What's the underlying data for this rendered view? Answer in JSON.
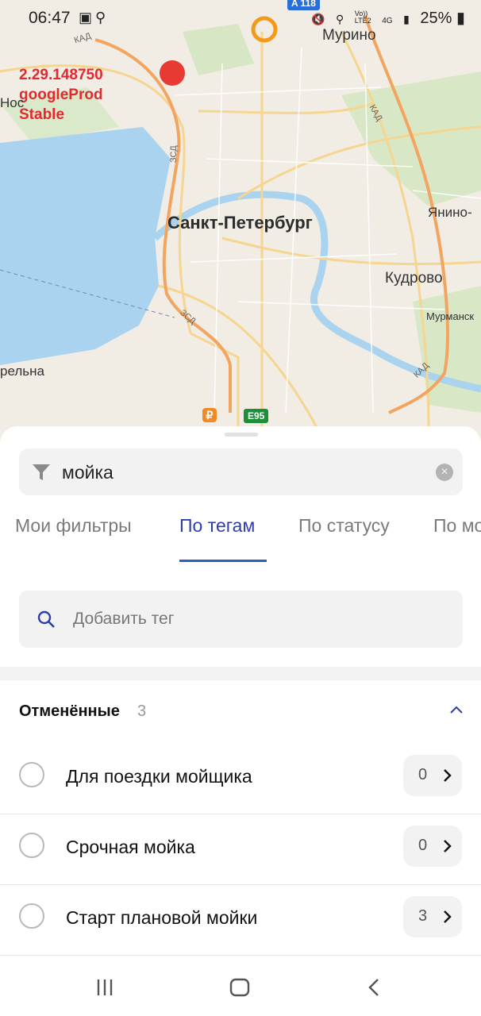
{
  "status_bar": {
    "time": "06:47",
    "left_icons": [
      "image-icon",
      "search-icon"
    ],
    "right_icons": [
      "mute-icon",
      "location-icon",
      "volte-icon",
      "4g-icon",
      "signal-icon"
    ],
    "volte": "Vo))\nLTE2",
    "network": "4G",
    "battery": "25%"
  },
  "map": {
    "build_lines": [
      "2.29.148750",
      "googleProd",
      "Stable"
    ],
    "city": "Санкт-Петербург",
    "places": {
      "murino": "Мурино",
      "yanino": "Янино-",
      "kudrovo": "Кудрово",
      "murmansk": "Мурманск",
      "nos": "Нос",
      "elna": "рельна"
    },
    "highways": {
      "kad_top": "КАД",
      "kad_right": "КАД",
      "kad_bottom": "КАД",
      "zsd_1": "ЗСД",
      "zsd_2": "ЗСД"
    },
    "route_badges": {
      "e95": "E95",
      "a118": "A 118"
    },
    "fuel_symbol": "₽",
    "colors": {
      "marker_red": "#e63a33",
      "marker_orange": "#f39a1a",
      "water": "#a9d3ee"
    }
  },
  "search": {
    "value": "мойка",
    "icons": [
      "filter-icon",
      "clear-icon"
    ],
    "clear_glyph": "×"
  },
  "tabs": [
    {
      "label": "Мои фильтры",
      "active": false
    },
    {
      "label": "По тегам",
      "active": true
    },
    {
      "label": "По статусу",
      "active": false
    },
    {
      "label": "По мо",
      "active": false
    }
  ],
  "tag_input": {
    "placeholder": "Добавить тег",
    "icon": "search-icon"
  },
  "section": {
    "title": "Отменённые",
    "count": "3",
    "icon": "chevron-up-icon"
  },
  "items": [
    {
      "label": "Для поездки мойщика",
      "count": "0"
    },
    {
      "label": "Срочная мойка",
      "count": "0"
    },
    {
      "label": "Старт плановой мойки",
      "count": "3"
    }
  ],
  "nav": [
    "recent-apps-icon",
    "home-icon",
    "back-icon"
  ],
  "colors": {
    "accent": "#2f3ea7",
    "underline": "#2a5fc4",
    "field_bg": "#f2f2f2",
    "build_label": "#e3292f"
  }
}
